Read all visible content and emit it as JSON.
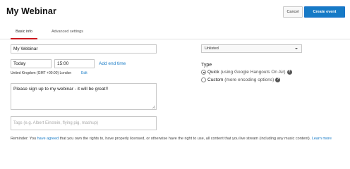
{
  "header": {
    "title": "My Webinar",
    "cancel_label": "Cancel",
    "create_label": "Create event"
  },
  "tabs": [
    {
      "label": "Basic info",
      "active": true
    },
    {
      "label": "Advanced settings",
      "active": false
    }
  ],
  "basic": {
    "title_value": "My Webinar",
    "date_value": "Today",
    "time_value": "15:00",
    "add_end_time_label": "Add end time",
    "timezone_text": "United Kingdom (GMT +00:00) London",
    "edit_label": "Edit",
    "description_value": "Please sign up to my webinar - it will be great!!",
    "tags_placeholder": "Tags (e.g. Albert Einstein, flying pig, mashup)"
  },
  "reminder": {
    "prefix": "Reminder: You ",
    "have_agreed_link": "have agreed",
    "middle": " that you own the rights to, have properly licensed, or otherwise have the right to use, all content that you live stream (including any music content). ",
    "learn_more_link": "Learn more"
  },
  "privacy": {
    "selected": "Unlisted"
  },
  "type": {
    "label": "Type",
    "options": [
      {
        "label": "Quick",
        "detail": "(using Google Hangouts On Air)",
        "selected": true
      },
      {
        "label": "Custom",
        "detail": "(more encoding options)",
        "selected": false
      }
    ]
  },
  "colors": {
    "accent": "#167ac6",
    "tab_underline": "#cc181e"
  }
}
